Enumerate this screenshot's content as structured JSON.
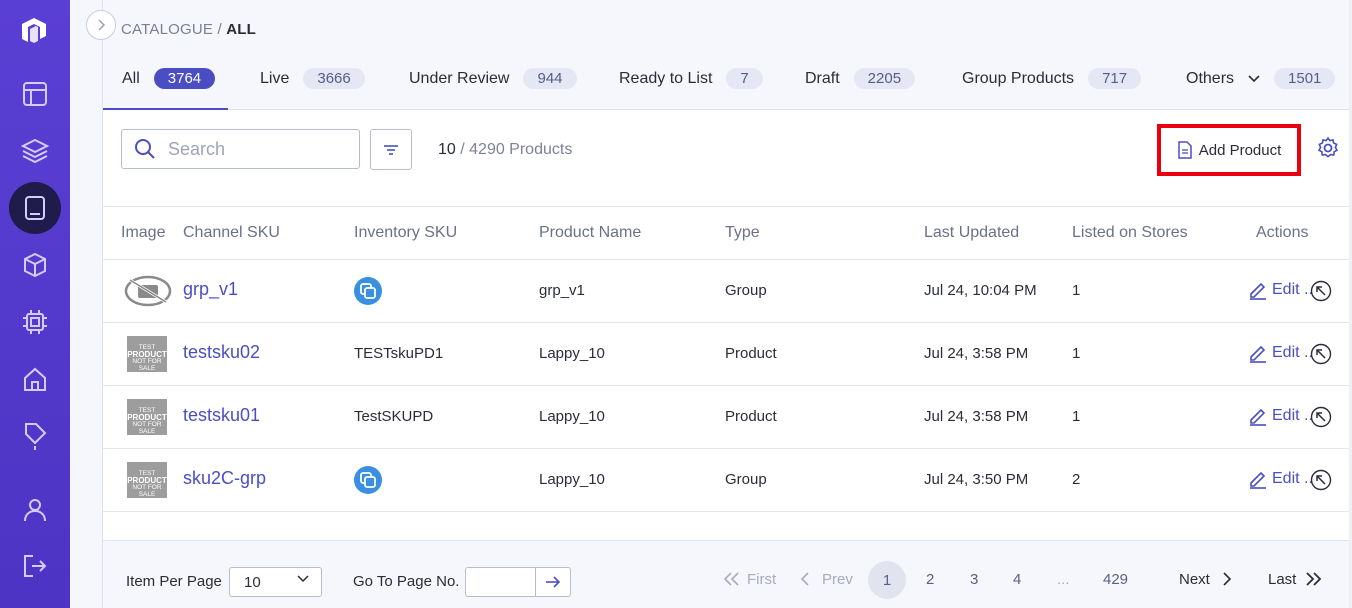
{
  "breadcrumb": {
    "root": "CATALOGUE",
    "separator": " / ",
    "current": "ALL"
  },
  "tabs": [
    {
      "label": "All",
      "count": "3764"
    },
    {
      "label": "Live",
      "count": "3666"
    },
    {
      "label": "Under Review",
      "count": "944"
    },
    {
      "label": "Ready to List",
      "count": "7"
    },
    {
      "label": "Draft",
      "count": "2205"
    },
    {
      "label": "Group Products",
      "count": "717"
    },
    {
      "label": "Others",
      "count": "1501"
    }
  ],
  "toolbar": {
    "search_placeholder": "Search",
    "shown": "10",
    "total": "/ 4290 Products",
    "add_label": "Add Product"
  },
  "columns": [
    "Image",
    "Channel SKU",
    "Inventory SKU",
    "Product Name",
    "Type",
    "Last Updated",
    "Listed on Stores",
    "Actions"
  ],
  "thumb_text": {
    "line1": "TEST",
    "line2": "PRODUCT",
    "line3": "NOT FOR SALE"
  },
  "rows": [
    {
      "channel_sku": "grp_v1",
      "inventory_sku": "",
      "name": "grp_v1",
      "type": "Group",
      "updated": "Jul 24, 10:04 PM",
      "stores": "1",
      "edit": "Edit ..",
      "image": "no-image",
      "inv_icon": true
    },
    {
      "channel_sku": "testsku02",
      "inventory_sku": "TESTskuPD1",
      "name": "Lappy_10",
      "type": "Product",
      "updated": "Jul 24, 3:58 PM",
      "stores": "1",
      "edit": "Edit ..",
      "image": "test-product",
      "inv_icon": false
    },
    {
      "channel_sku": "testsku01",
      "inventory_sku": "TestSKUPD",
      "name": "Lappy_10",
      "type": "Product",
      "updated": "Jul 24, 3:58 PM",
      "stores": "1",
      "edit": "Edit ..",
      "image": "test-product",
      "inv_icon": false
    },
    {
      "channel_sku": "sku2C-grp",
      "inventory_sku": "",
      "name": "Lappy_10",
      "type": "Group",
      "updated": "Jul 24, 3:50 PM",
      "stores": "2",
      "edit": "Edit ..",
      "image": "test-product",
      "inv_icon": true
    }
  ],
  "footer": {
    "per_page_label": "Item Per Page",
    "per_page_value": "10",
    "goto_label": "Go To Page No.",
    "first": "First",
    "prev": "Prev",
    "pages": [
      "1",
      "2",
      "3",
      "4",
      "...",
      "429"
    ],
    "next": "Next",
    "last": "Last"
  },
  "colors": {
    "sidebar": "#5a3fd4",
    "accent": "#4a4ec2",
    "highlight_border": "#e8000e",
    "active_nav": "#1f1b4a"
  }
}
